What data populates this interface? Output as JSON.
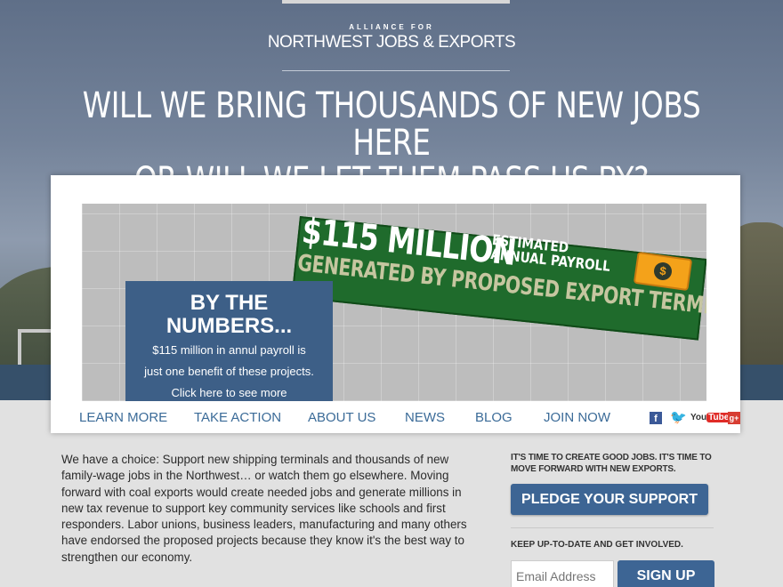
{
  "brand": {
    "small": "ALLIANCE FOR",
    "big": "NORTHWEST JOBS & EXPORTS"
  },
  "headline": {
    "line1": "WILL WE BRING THOUSANDS OF NEW JOBS HERE",
    "line2": "OR WILL WE LET THEM PASS US BY?"
  },
  "banner": {
    "amount": "$115 MILLION",
    "estimated": "ESTIMATED",
    "annual": "ANNUAL PAYROLL",
    "generated": "GENERATED BY PROPOSED EXPORT TERMINALS",
    "money_symbol": "$"
  },
  "numbers_box": {
    "title_line1": "BY THE",
    "title_line2": "NUMBERS...",
    "text_line1": "$115 million in annul payroll is",
    "text_line2": "just one benefit of these projects.",
    "link": "Click here to see more"
  },
  "nav": {
    "items": [
      "LEARN MORE",
      "TAKE ACTION",
      "ABOUT US",
      "NEWS",
      "BLOG",
      "JOIN NOW"
    ],
    "social": {
      "facebook": "f",
      "twitter": "🐦",
      "youtube_you": "You",
      "youtube_tube": "Tube",
      "googleplus": "g+"
    }
  },
  "body": {
    "paragraph": "We have a choice: Support new shipping terminals and thousands of new family-wage jobs in the Northwest… or watch them go elsewhere. Moving forward with coal exports would create needed jobs and generate millions in new tax revenue to support key community services like schools and first responders. Labor unions, business leaders, manufacturing and many others have endorsed the proposed projects because they know it's the best way to strengthen our economy."
  },
  "aside": {
    "title": "IT'S TIME TO CREATE GOOD JOBS. IT'S TIME TO MOVE FORWARD WITH NEW EXPORTS.",
    "pledge_label": "PLEDGE YOUR SUPPORT",
    "title2": "KEEP UP-TO-DATE AND GET INVOLVED.",
    "email_placeholder": "Email Address",
    "signup_label": "SIGN UP"
  }
}
